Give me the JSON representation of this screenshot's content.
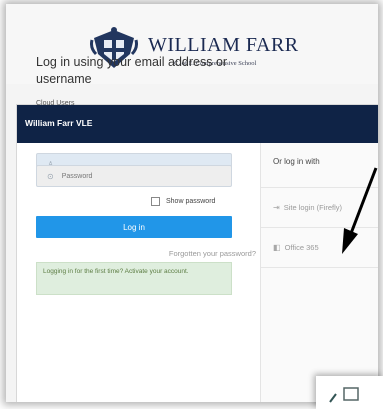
{
  "header": {
    "school_name": "WILLIAM FARR",
    "school_subtitle": "C. of E. Comprehensive School"
  },
  "card": {
    "title": "William Farr VLE",
    "heading": "Log in using your email address or username",
    "realm": "Cloud Users",
    "username": {
      "value": "",
      "placeholder": ""
    },
    "password": {
      "value": "",
      "placeholder": "Password"
    },
    "show_password_label": "Show password",
    "login_button": "Log in",
    "forgot_link": "Forgotten your password?",
    "first_time_notice": "Logging in for the first time? Activate your account."
  },
  "alt_login": {
    "heading": "Or log in with",
    "options": [
      "Site login (Firefly)",
      "Office 365"
    ]
  },
  "colors": {
    "title_bar": "#0f2346",
    "button": "#2196e8",
    "arrow": "#000000",
    "notice_bg": "#dfeede"
  }
}
